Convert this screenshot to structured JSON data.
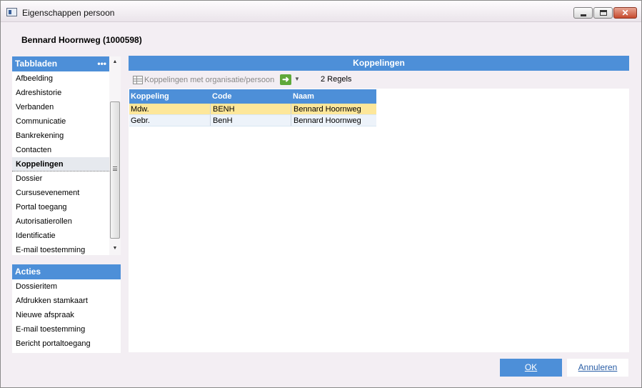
{
  "window": {
    "title": "Eigenschappen persoon"
  },
  "person": {
    "name": "Bennard Hoornweg (1000598)"
  },
  "tabbladen": {
    "header": "Tabbladen",
    "menu_dots": "•••",
    "items": [
      {
        "label": "Afbeelding"
      },
      {
        "label": "Adreshistorie"
      },
      {
        "label": "Verbanden"
      },
      {
        "label": "Communicatie"
      },
      {
        "label": "Bankrekening"
      },
      {
        "label": "Contacten"
      },
      {
        "label": "Koppelingen"
      },
      {
        "label": "Dossier"
      },
      {
        "label": "Cursusevenement"
      },
      {
        "label": "Portal toegang"
      },
      {
        "label": "Autorisatierollen"
      },
      {
        "label": "Identificatie"
      },
      {
        "label": "E-mail toestemming"
      }
    ],
    "active": "Koppelingen"
  },
  "acties": {
    "header": "Acties",
    "items": [
      {
        "label": "Dossieritem"
      },
      {
        "label": "Afdrukken stamkaart"
      },
      {
        "label": "Nieuwe afspraak"
      },
      {
        "label": "E-mail toestemming"
      },
      {
        "label": "Bericht portaltoegang"
      }
    ]
  },
  "main": {
    "header": "Koppelingen",
    "toolbar": {
      "link_label": "Koppelingen met organisatie/persoon",
      "go_icon": "arrow-right-icon",
      "dropdown_icon": "chevron-down-icon",
      "count_label": "2 Regels"
    },
    "grid": {
      "columns": [
        "Koppeling",
        "Code",
        "Naam"
      ],
      "rows": [
        {
          "koppeling": "Mdw.",
          "code": "BENH",
          "naam": "Bennard Hoornweg"
        },
        {
          "koppeling": "Gebr.",
          "code": "BenH",
          "naam": "Bennard Hoornweg"
        }
      ]
    }
  },
  "buttons": {
    "ok_label": "OK",
    "cancel_label": "Annuleren"
  },
  "colors": {
    "accent": "#4d8fd8",
    "selected_row": "#fde79a",
    "dialog_bg": "#f3eef3"
  }
}
